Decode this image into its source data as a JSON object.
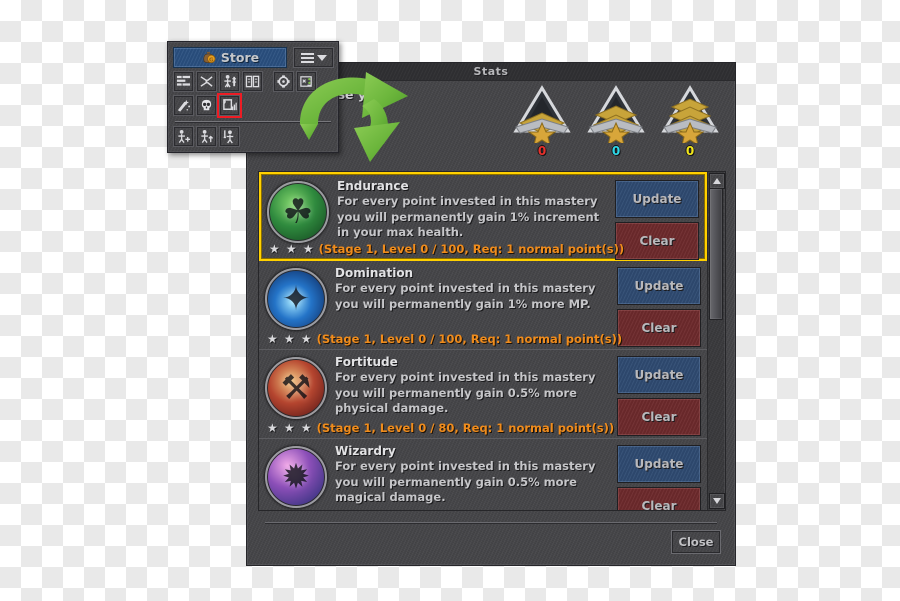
{
  "colors": {
    "accent_selected": "#ffd000",
    "stage_text": "#f08c1c",
    "update_button": "#2f4b72",
    "clear_button": "#6e2a2c",
    "store_button": "#2a5080",
    "highlight_outline": "#ee1c24",
    "arrow_green": "#67b43a",
    "panel_stone": "#454548"
  },
  "stats_window": {
    "title": "Stats",
    "header_note": "to increase your",
    "close_label": "Close",
    "ranks": [
      {
        "name": "rank-badge-normal",
        "chevrons": 1,
        "count": "0",
        "count_color": "#e8312b"
      },
      {
        "name": "rank-badge-special",
        "chevrons": 2,
        "count": "0",
        "count_color": "#2fd8e8"
      },
      {
        "name": "rank-badge-elite",
        "chevrons": 3,
        "count": "0",
        "count_color": "#f2e71c"
      }
    ],
    "buttons": {
      "update_label": "Update",
      "clear_label": "Clear"
    },
    "stars": "★ ★ ★",
    "scrollbar": {
      "up_icon": "triangle-up-icon",
      "down_icon": "triangle-down-icon",
      "thumb_position_percent": 0,
      "thumb_size_percent": 43
    },
    "masteries": [
      {
        "name": "Endurance",
        "description": "For every point invested in this mastery you will permanently gain 1% increment in your max health.",
        "stage": "(Stage 1, Level 0 / 100, Req: 1 normal point(s))",
        "selected": true,
        "icon_name": "endurance-mastery-icon",
        "icon_glyph": "⚘",
        "icon_bg": "radial-gradient(circle at 40% 35%, #7fd36a 0%, #2f8a3e 45%, #10401c 100%)"
      },
      {
        "name": "Domination",
        "description": "For every point invested in this mastery you will permanently gain 1% more MP.",
        "stage": "(Stage 1, Level 0 / 100, Req: 1 normal point(s))",
        "selected": false,
        "icon_name": "domination-mastery-icon",
        "icon_glyph": "✦",
        "icon_bg": "radial-gradient(circle at 45% 55%, #9fe4ff 0%, #2474c8 40%, #0b1d4d 100%)"
      },
      {
        "name": "Fortitude",
        "description": "For every point invested in this mastery you will permanently gain 0.5% more physical damage.",
        "stage": "(Stage 1, Level 0 / 80, Req: 1 normal point(s))",
        "selected": false,
        "icon_name": "fortitude-mastery-icon",
        "icon_glyph": "⚒",
        "icon_bg": "radial-gradient(circle at 42% 38%, #f0c07a 0%, #b5452f 45%, #4a0f12 100%)"
      },
      {
        "name": "Wizardry",
        "description": "For every point invested in this mastery you will permanently gain 0.5% more magical damage.",
        "stage": "",
        "selected": false,
        "icon_name": "wizardry-mastery-icon",
        "icon_glyph": "✹",
        "icon_bg": "radial-gradient(circle at 35% 30%, #f0a8e8 0%, #8c4fb8 40%, #1d2a6e 100%)"
      }
    ]
  },
  "toolbar_window": {
    "store_label": "Store",
    "store_icon": "money-bag-icon",
    "menu_icon": "hamburger-menu-icon",
    "menu_caret_icon": "chevron-down-icon",
    "row1_icons": [
      "quest-log-icon",
      "skill-tree-icon",
      "character-stats-icon",
      "spellbook-icon",
      "achievements-icon"
    ],
    "row1_icons_right": [
      "settings-gear-icon",
      "keybindings-icon"
    ],
    "row2_icons": [
      "crafting-wand-icon",
      "bestiary-skull-icon",
      "stats-chart-icon"
    ],
    "row3_icons": [
      "summon-ally-icon",
      "revive-ally-icon",
      "equip-weapon-icon"
    ],
    "highlighted_icon": "stats-chart-icon"
  },
  "annotation": {
    "arrow_icon": "curved-green-arrow"
  }
}
